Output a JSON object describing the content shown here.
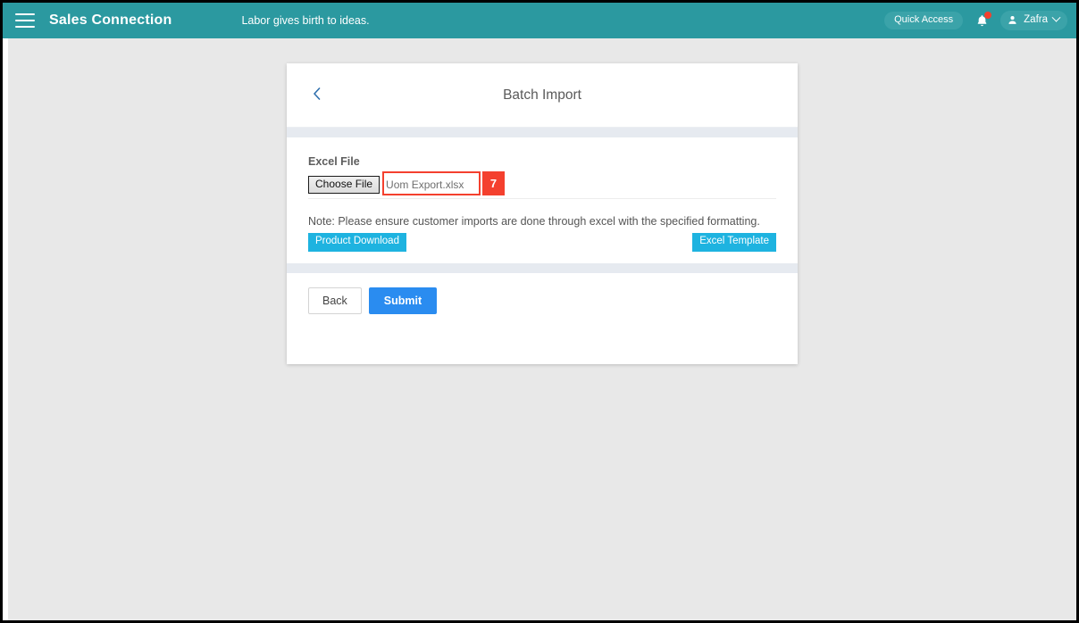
{
  "topbar": {
    "menu_icon": "hamburger-icon",
    "brand": "Sales Connection",
    "tagline": "Labor gives birth to ideas.",
    "quick_access_label": "Quick Access",
    "bell_icon": "bell-icon",
    "user_name": "Zafra",
    "user_icon": "person-icon",
    "chevron_icon": "chevron-down-icon",
    "bg_color": "#2b99a0"
  },
  "card": {
    "back_icon": "chevron-left-icon",
    "title": "Batch Import",
    "form": {
      "file_label": "Excel File",
      "choose_button": "Choose File",
      "file_name": "Uom Export.xlsx",
      "note": "Note: Please ensure customer imports are done through excel with the specified formatting.",
      "product_download_label": "Product Download",
      "excel_template_label": "Excel Template"
    },
    "footer": {
      "back_label": "Back",
      "submit_label": "Submit"
    }
  },
  "annotation": {
    "step_number": "7",
    "color": "#f4402e"
  }
}
